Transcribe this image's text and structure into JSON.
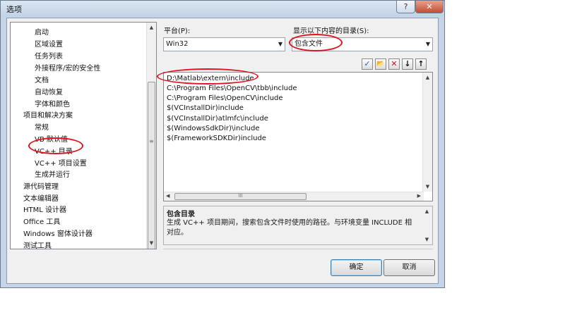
{
  "window": {
    "title": "选项",
    "help_glyph": "?",
    "close_glyph": "✕"
  },
  "tree": {
    "items": [
      {
        "label": "启动",
        "level": 2
      },
      {
        "label": "区域设置",
        "level": 2
      },
      {
        "label": "任务列表",
        "level": 2
      },
      {
        "label": "外接程序/宏的安全性",
        "level": 2
      },
      {
        "label": "文档",
        "level": 2
      },
      {
        "label": "自动恢复",
        "level": 2
      },
      {
        "label": "字体和颜色",
        "level": 2
      },
      {
        "label": "项目和解决方案",
        "level": 1
      },
      {
        "label": "常规",
        "level": 2
      },
      {
        "label": "VB 默认值",
        "level": 2
      },
      {
        "label": "VC++ 目录",
        "level": 2
      },
      {
        "label": "VC++ 项目设置",
        "level": 2
      },
      {
        "label": "生成并运行",
        "level": 2
      },
      {
        "label": "源代码管理",
        "level": 1
      },
      {
        "label": "文本编辑器",
        "level": 1
      },
      {
        "label": "HTML 设计器",
        "level": 1
      },
      {
        "label": "Office 工具",
        "level": 1
      },
      {
        "label": "Windows 窗体设计器",
        "level": 1
      },
      {
        "label": "测试工具",
        "level": 1
      }
    ]
  },
  "platform": {
    "label": "平台(P):",
    "value": "Win32"
  },
  "show_dirs": {
    "label": "显示以下内容的目录(S):",
    "value": "包含文件"
  },
  "toolbar": {
    "check": "✓",
    "folder": "📂",
    "delete": "✕",
    "down": "↓",
    "up": "↑"
  },
  "paths": [
    "D:\\Matlab\\extern\\include",
    "C:\\Program Files\\OpenCV\\tbb\\include",
    "C:\\Program Files\\OpenCV\\include",
    "$(VCInstallDir)include",
    "$(VCInstallDir)atlmfc\\include",
    "$(WindowsSdkDir)\\include",
    "$(FrameworkSDKDir)include"
  ],
  "description": {
    "title": "包含目录",
    "text": "生成 VC++ 项目期间，搜索包含文件时使用的路径。与环境变量 INCLUDE 相对应。"
  },
  "buttons": {
    "ok": "确定",
    "cancel": "取消"
  },
  "highlight_color": "#e0141e"
}
